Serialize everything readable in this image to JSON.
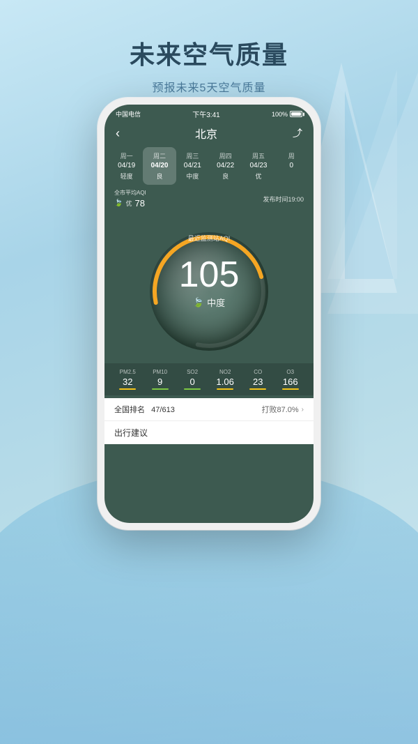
{
  "background": {
    "gradient_start": "#c8e8f5",
    "gradient_end": "#d0e8f0"
  },
  "header": {
    "main_title": "未来空气质量",
    "sub_title": "预报未来5天空气质量"
  },
  "phone": {
    "status_bar": {
      "carrier": "中国电信",
      "wifi_icon": "wifi",
      "time": "下午3:41",
      "battery": "100%"
    },
    "nav": {
      "back_icon": "‹",
      "title": "北京",
      "share_icon": "⤴"
    },
    "days": [
      {
        "name": "周一",
        "date": "04/19",
        "quality": "轻度",
        "active": false
      },
      {
        "name": "周二",
        "date": "04/20",
        "quality": "良",
        "active": true
      },
      {
        "name": "周三",
        "date": "04/21",
        "quality": "中度",
        "active": false
      },
      {
        "name": "周四",
        "date": "04/22",
        "quality": "良",
        "active": false
      },
      {
        "name": "周五",
        "date": "04/23",
        "quality": "优",
        "active": false
      },
      {
        "name": "周",
        "date": "0",
        "quality": "",
        "active": false
      }
    ],
    "aqi_info": {
      "label": "全市平均AQI",
      "leaf_icon": "🍃",
      "quality": "优",
      "value": 78,
      "publish_time": "发布时间19:00"
    },
    "gauge": {
      "label": "最近监测站AQI",
      "value": 105,
      "quality": "中度",
      "leaf_icon": "🍃"
    },
    "pollutants": [
      {
        "name": "PM2.5",
        "value": "32",
        "bar_color": "yellow"
      },
      {
        "name": "PM10",
        "value": "9",
        "bar_color": "green"
      },
      {
        "name": "SO2",
        "value": "0",
        "bar_color": "green"
      },
      {
        "name": "NO2",
        "value": "1.06",
        "bar_color": "yellow"
      },
      {
        "name": "CO",
        "value": "23",
        "bar_color": "yellow"
      },
      {
        "name": "O3",
        "value": "166",
        "bar_color": "yellow"
      }
    ],
    "ranking": {
      "label": "全国排名",
      "value": "47/613",
      "defeat_label": "打败87.0%",
      "arrow": ">"
    },
    "travel": {
      "title": "出行建议"
    }
  }
}
